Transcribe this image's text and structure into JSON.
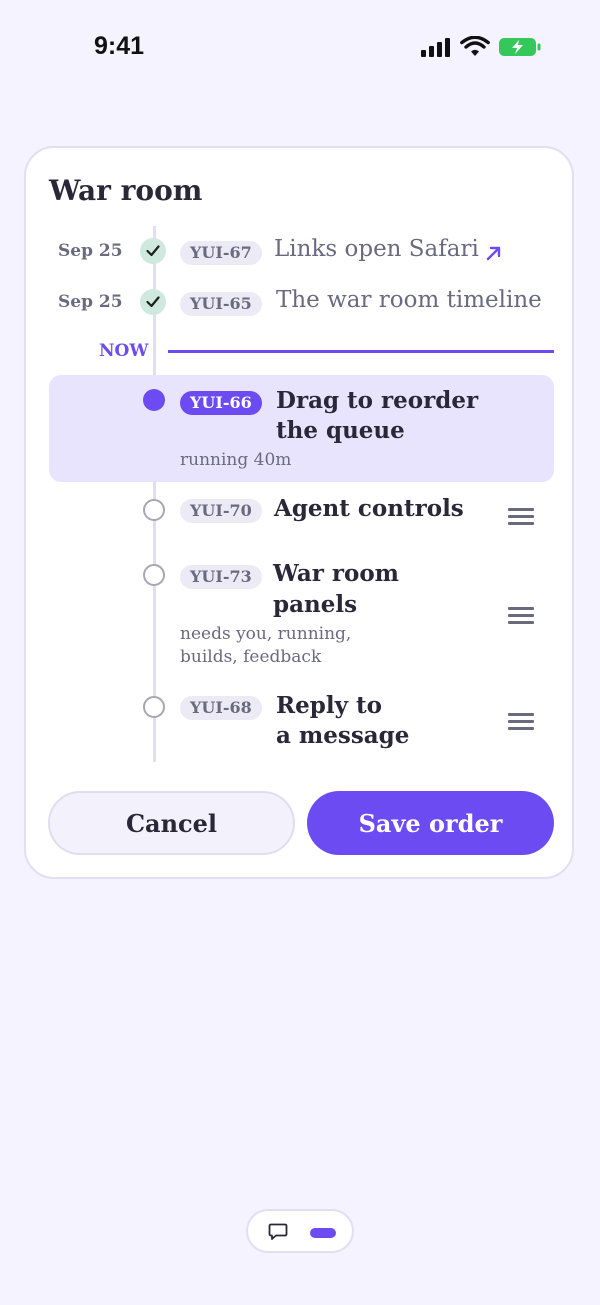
{
  "status_bar": {
    "time": "9:41"
  },
  "card": {
    "title": "War room",
    "done_items": [
      {
        "date": "Sep 25",
        "id": "YUI-67",
        "title": "Links open Safari",
        "link": true
      },
      {
        "date": "Sep 25",
        "id": "YUI-65",
        "title": "The war room timeline"
      }
    ],
    "now_label": "NOW",
    "active_item": {
      "id": "YUI-66",
      "title_line1": "Drag to reorder",
      "title_line2": "the queue",
      "sub": "running 40m"
    },
    "queue": [
      {
        "id": "YUI-70",
        "title_line1": "Agent controls",
        "title_line2": ""
      },
      {
        "id": "YUI-73",
        "title_line1": "War room",
        "title_line2": "panels",
        "sub_line1": "needs you, running,",
        "sub_line2": "builds, feedback"
      },
      {
        "id": "YUI-68",
        "title_line1": "Reply to",
        "title_line2": "a message"
      }
    ],
    "cancel_label": "Cancel",
    "save_label": "Save order"
  },
  "colors": {
    "accent": "#6c4cf2",
    "done": "#cfe9de",
    "background": "#f5f3ff"
  }
}
